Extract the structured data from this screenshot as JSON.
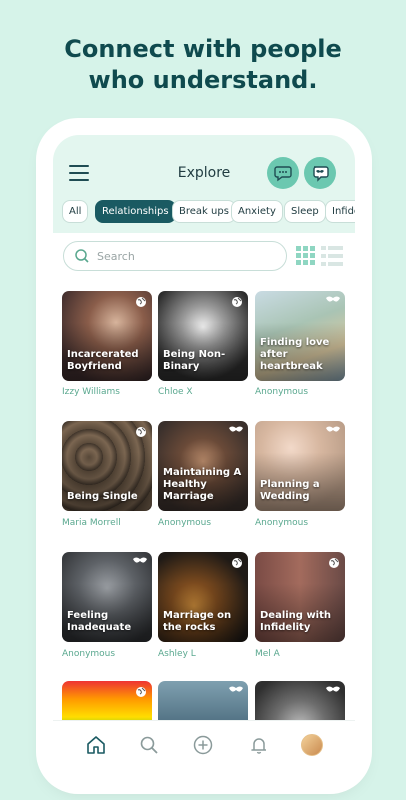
{
  "headline": {
    "line1": "Connect with people",
    "line2": "who understand."
  },
  "header": {
    "title": "Explore",
    "menu_icon": "hamburger-icon",
    "chat_icon": "chat-bubble-icon",
    "mask_icon": "mask-chat-icon"
  },
  "chips": [
    {
      "label": "All",
      "active": false
    },
    {
      "label": "Relationships",
      "active": true
    },
    {
      "label": "Break ups",
      "active": false
    },
    {
      "label": "Anxiety",
      "active": false
    },
    {
      "label": "Sleep",
      "active": false
    },
    {
      "label": "Infide",
      "active": false
    }
  ],
  "search": {
    "placeholder": "Search"
  },
  "colors": {
    "accent": "#1a5a62",
    "mint": "#6bc8b0",
    "background": "#d6f3e9",
    "author_text": "#5aa88f"
  },
  "groups": [
    {
      "title": "Incarcerated Boyfriend",
      "author": "Izzy Williams",
      "badge": "globe-icon"
    },
    {
      "title": "Being Non-Binary",
      "author": "Chloe X",
      "badge": "globe-icon"
    },
    {
      "title": "Finding love after heartbreak",
      "author": "Anonymous",
      "badge": "mask-icon"
    },
    {
      "title": "Being Single",
      "author": "Maria Morrell",
      "badge": "globe-icon"
    },
    {
      "title": "Maintaining A Healthy Marriage",
      "author": "Anonymous",
      "badge": "mask-icon"
    },
    {
      "title": "Planning a Wedding",
      "author": "Anonymous",
      "badge": "mask-icon"
    },
    {
      "title": "Feeling Inadequate",
      "author": "Anonymous",
      "badge": "mask-icon"
    },
    {
      "title": "Marriage on the rocks",
      "author": "Ashley L",
      "badge": "globe-icon"
    },
    {
      "title": "Dealing with Infidelity",
      "author": "Mel A",
      "badge": "globe-icon"
    },
    {
      "title": "",
      "author": "",
      "badge": "globe-icon"
    },
    {
      "title": "",
      "author": "",
      "badge": "mask-icon"
    },
    {
      "title": "",
      "author": "",
      "badge": "mask-icon"
    }
  ],
  "bottom_nav": [
    {
      "name": "home-icon",
      "active": true
    },
    {
      "name": "search-icon",
      "active": false
    },
    {
      "name": "add-icon",
      "active": false
    },
    {
      "name": "bell-icon",
      "active": false
    },
    {
      "name": "profile-avatar",
      "active": false
    }
  ]
}
